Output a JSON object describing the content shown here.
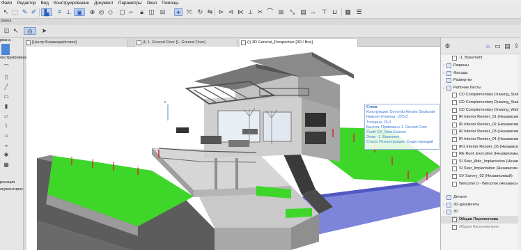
{
  "menu": [
    "Файл",
    "Редактор",
    "Вид",
    "Конструирование",
    "Документ",
    "Параметры",
    "Окно",
    "Помощь"
  ],
  "toolbox": {
    "info_label": "рвана",
    "header_label": "онструирование",
    "bottom_label_1": "роекция",
    "bottom_label_2": "окументирос"
  },
  "tabs": [
    "[Центр Взаимодействия]",
    "(I) 1. Ground Floor [1. Ground Floor]",
    "(I) 3D General_Perspective [3D / Все]"
  ],
  "tooltip": {
    "title": "Стена",
    "lines": [
      "Конструкция: Cemento Armato Strutturale",
      "Нижняя Отметка: -375,0",
      "Толщина: 25,0",
      "Высота: Привязан к 1. Ground Floor",
      "Слой: EX_Strut-Esterno",
      "Этаж: -1. Basement",
      "Статус Реконструкции: Существующий"
    ]
  },
  "navigator": {
    "items": [
      {
        "label": "-1. Basement",
        "indent": 2,
        "kind": "doc"
      },
      {
        "label": "Разрезы",
        "indent": 1,
        "kind": "folder",
        "chevron": "›"
      },
      {
        "label": "Фасады",
        "indent": 1,
        "kind": "folder",
        "chevron": "›"
      },
      {
        "label": "Развертки",
        "indent": 1,
        "kind": "folder",
        "chevron": ""
      },
      {
        "label": "Рабочие Листы",
        "indent": 1,
        "kind": "folder",
        "chevron": "⌄"
      },
      {
        "label": "CD Complementary Drawing_Stair",
        "indent": 2,
        "kind": "doc"
      },
      {
        "label": "CD Complementary Drawing_Stair",
        "indent": 2,
        "kind": "doc"
      },
      {
        "label": "CD Complementary Drawing_Wall",
        "indent": 2,
        "kind": "doc"
      },
      {
        "label": "IR Interior Render_01 (Независим",
        "indent": 2,
        "kind": "doc"
      },
      {
        "label": "IR Interior Render_02 (Независим",
        "indent": 2,
        "kind": "doc"
      },
      {
        "label": "IR Interior Render_03 (Независим",
        "indent": 2,
        "kind": "doc"
      },
      {
        "label": "IR Interior Render_04 (Независим",
        "indent": 2,
        "kind": "doc"
      },
      {
        "label": "IR1 Interior Render_05 (Независим",
        "indent": 2,
        "kind": "doc"
      },
      {
        "label": "RE Roof_Executive (Независимый",
        "indent": 2,
        "kind": "doc"
      },
      {
        "label": "SI Stair_Attic_Implantation (Незав",
        "indent": 2,
        "kind": "doc"
      },
      {
        "label": "SI Stair_Implantation (Независим",
        "indent": 2,
        "kind": "doc"
      },
      {
        "label": "SV Survey_02 (Независимый)",
        "indent": 2,
        "kind": "doc"
      },
      {
        "label": "Welcome 0 - Welcome (Независи",
        "indent": 2,
        "kind": "doc"
      },
      {
        "label": "Детали",
        "indent": 1,
        "kind": "folder",
        "chevron": ""
      },
      {
        "label": "3D-документы",
        "indent": 1,
        "kind": "folder",
        "chevron": "›"
      },
      {
        "label": "3D",
        "indent": 1,
        "kind": "folder",
        "chevron": "⌄"
      },
      {
        "label": "Общая Перспектива",
        "indent": 2,
        "kind": "doc",
        "highlight": true
      }
    ],
    "partial_bottom": "Общая Аксонометрия"
  },
  "colors": {
    "grass": "#3fd62a",
    "tooltip_text": "#3b78d8",
    "selection": "#4f86d9"
  }
}
